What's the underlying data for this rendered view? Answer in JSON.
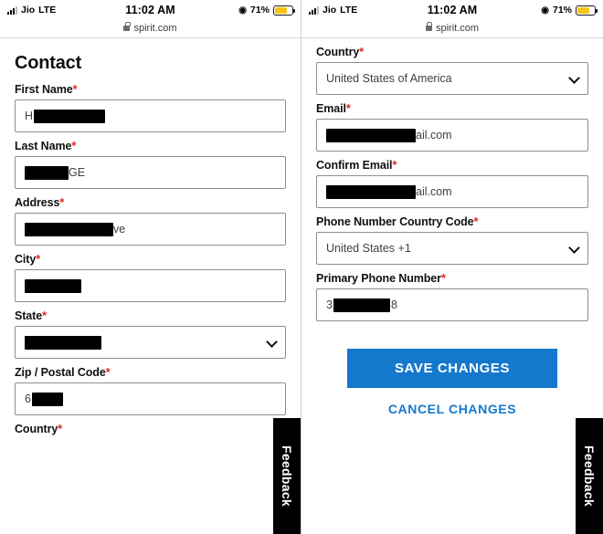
{
  "status_bar": {
    "carrier": "Jio",
    "network": "LTE",
    "time": "11:02 AM",
    "battery_percent": "71%",
    "battery_level": 71,
    "location_icon": "location-arrow-icon",
    "signal_icon": "signal-bars-icon"
  },
  "browser": {
    "url": "spirit.com",
    "lock_icon": "lock-icon"
  },
  "left_screen": {
    "heading": "Contact",
    "fields": [
      {
        "label": "First Name",
        "required": true,
        "value": "H",
        "redacted": true,
        "type": "text"
      },
      {
        "label": "Last Name",
        "required": true,
        "value": "GE",
        "redacted": true,
        "type": "text"
      },
      {
        "label": "Address",
        "required": true,
        "value": "ve",
        "redacted": true,
        "type": "text"
      },
      {
        "label": "City",
        "required": true,
        "value": "",
        "redacted": true,
        "type": "text"
      },
      {
        "label": "State",
        "required": true,
        "value": "",
        "redacted": true,
        "type": "select"
      },
      {
        "label": "Zip / Postal Code",
        "required": true,
        "value": "6",
        "redacted": true,
        "type": "text"
      },
      {
        "label": "Country",
        "required": true,
        "value": "",
        "redacted": false,
        "type": "text"
      }
    ]
  },
  "right_screen": {
    "fields": [
      {
        "label": "Country",
        "required": true,
        "value": "United States of America",
        "redacted": false,
        "type": "select"
      },
      {
        "label": "Email",
        "required": true,
        "value": "ail.com",
        "redacted": true,
        "type": "text"
      },
      {
        "label": "Confirm Email",
        "required": true,
        "value": "ail.com",
        "redacted": true,
        "type": "text"
      },
      {
        "label": "Phone Number Country Code",
        "required": true,
        "value": "United States +1",
        "redacted": false,
        "type": "select"
      },
      {
        "label": "Primary Phone Number",
        "required": true,
        "value": "3",
        "value_suffix": "8",
        "redacted": true,
        "type": "text"
      }
    ],
    "save_label": "SAVE CHANGES",
    "cancel_label": "CANCEL CHANGES"
  },
  "feedback_tab": {
    "label": "Feedback"
  },
  "colors": {
    "accent": "#1478cd",
    "required": "#e2231a",
    "battery": "#f5c518",
    "redaction": "#000000"
  }
}
